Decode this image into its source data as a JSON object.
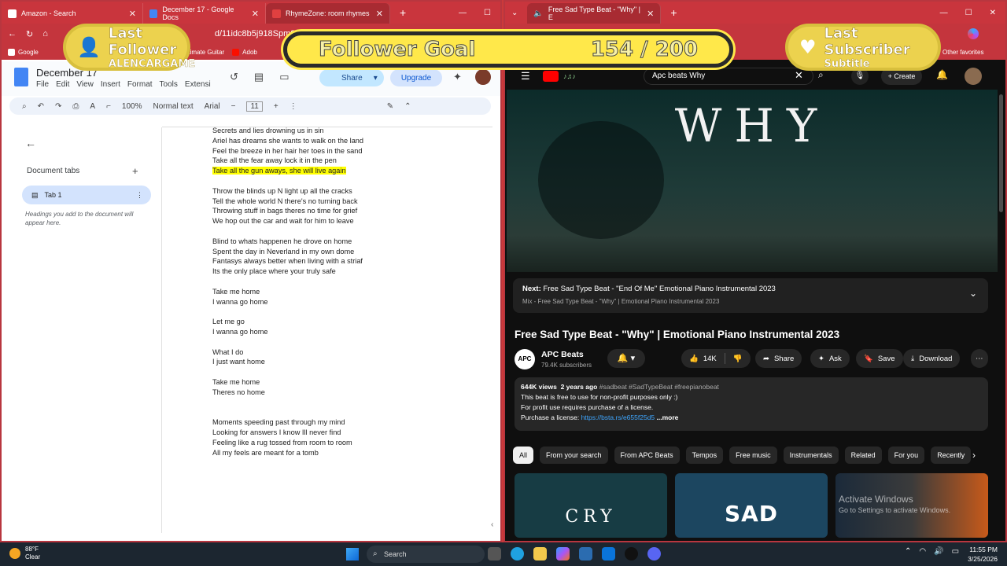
{
  "left_browser": {
    "tabs": [
      {
        "title": "Amazon - Search",
        "color": "#ffffff"
      },
      {
        "title": "December 17 - Google Docs",
        "color": "#4285f4"
      },
      {
        "title": "RhymeZone: room rhymes",
        "color": "#e04040"
      }
    ],
    "active_tab_index": 2,
    "url": "d/11idc8b5j918Spm8AixFcsQcIE...",
    "bookmarks": [
      "Google",
      "Ultimate Guitar",
      "Adob"
    ]
  },
  "docs": {
    "title": "December 17",
    "menu": [
      "File",
      "Edit",
      "View",
      "Insert",
      "Format",
      "Tools",
      "Extensi"
    ],
    "share_label": "Share",
    "upgrade_label": "Upgrade",
    "toolbar": {
      "zoom": "100%",
      "style": "Normal text",
      "font": "Arial",
      "font_size": "11"
    },
    "sidebar": {
      "heading": "Document tabs",
      "tab_label": "Tab 1",
      "hint": "Headings you add to the document will appear here."
    },
    "lines": [
      "Secrets and lies drowning us in sin",
      "Ariel has dreams she wants to walk on the land",
      "Feel the breeze in her hair her toes in the sand",
      "Take all the fear away lock it in the pen",
      "Take all the gun aways, she will live again",
      "",
      "Throw the blinds up N light up all the cracks",
      "Tell the whole world N there's no turning back",
      "Throwing stuff in bags theres no time for grief",
      "We hop out the car and wait for him to leave",
      "",
      "Blind to whats happenen he drove on home",
      "Spent the day in Neverland in my own dome",
      "Fantasys always better when living with a striaf",
      "Its the only place where your truly safe",
      "",
      "Take me home",
      "I wanna go home",
      "",
      "Let me go",
      "I wanna go home",
      "",
      "What I do",
      "I just want home",
      "",
      "Take me home",
      "Theres no home",
      "",
      "",
      "Moments speeding past through my mind",
      "Looking for answers I know Ill never find",
      "Feeling like a rug tossed from room to room",
      "All my feels are meant for a tomb"
    ],
    "highlight_line_index": 4,
    "highlight_color": "#ffff00"
  },
  "overlay": {
    "last_follower_label": "Last Follower",
    "last_follower_name": "ALENCARGAME",
    "goal_label": "Follower Goal",
    "goal_count": "154 / 200",
    "last_subscriber_label": "Last Subscriber",
    "last_subscriber_name": "Subtitle"
  },
  "right_browser": {
    "tab_title": "Free Sad Type Beat - \"Why\" | E",
    "bookmarks_right": [
      "Other favorites"
    ]
  },
  "youtube": {
    "search_query": "Apc beats Why",
    "create_label": "Create",
    "video_overlay_title": "WHY",
    "next": {
      "prefix": "Next:",
      "title": "Free Sad Type Beat - \"End Of Me\" Emotional Piano Instrumental 2023",
      "sub": "Mix - Free Sad Type Beat - \"Why\" | Emotional Piano Instrumental 2023"
    },
    "title": "Free Sad Type Beat - \"Why\" | Emotional Piano Instrumental 2023",
    "channel": {
      "logo": "APC",
      "name": "APC Beats",
      "subs": "79.4K subscribers"
    },
    "likes": "14K",
    "share": "Share",
    "ask": "Ask",
    "save": "Save",
    "download": "Download",
    "desc": {
      "views": "644K views",
      "age": "2 years ago",
      "tags": "#sadbeat #SadTypeBeat #freepianobeat",
      "line1": "This beat is free to use for non-profit purposes only :)",
      "line2": "For profit use requires purchase of a license.",
      "line3_label": "Purchase a license:",
      "line3_link": "https://bsta.rs/e655f25d5",
      "more": "...more"
    },
    "chips": [
      "All",
      "From your search",
      "From APC Beats",
      "Tempos",
      "Free music",
      "Instrumentals",
      "Related",
      "For you",
      "Recently"
    ],
    "thumbs": [
      {
        "label": "CRY",
        "bg": "#173c44"
      },
      {
        "label": "SAD",
        "bg": "#1c4660"
      },
      {
        "label": "",
        "bg": "#2a2a2a"
      }
    ],
    "activate": {
      "title": "Activate Windows",
      "sub": "Go to Settings to activate Windows."
    }
  },
  "taskbar": {
    "temp": "88°F",
    "weather": "Clear",
    "search_placeholder": "Search",
    "time": "11:55 PM",
    "date": "3/25/2026"
  }
}
